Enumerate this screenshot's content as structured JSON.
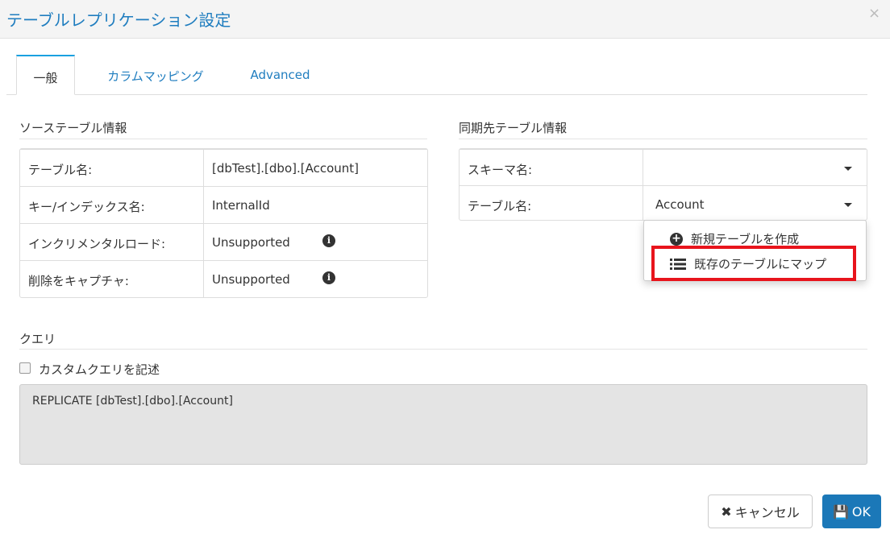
{
  "dialog": {
    "title": "テーブルレプリケーション設定",
    "close": "×"
  },
  "tabs": [
    {
      "label": "一般"
    },
    {
      "label": "カラムマッピング"
    },
    {
      "label": "Advanced"
    }
  ],
  "source": {
    "heading": "ソーステーブル情報",
    "rows": [
      {
        "label": "テーブル名:",
        "value": "[dbTest].[dbo].[Account]"
      },
      {
        "label": "キー/インデックス名:",
        "value": "InternalId"
      },
      {
        "label": "インクリメンタルロード:",
        "value": "Unsupported"
      },
      {
        "label": "削除をキャプチャ:",
        "value": "Unsupported"
      }
    ]
  },
  "target": {
    "heading": "同期先テーブル情報",
    "rows": [
      {
        "label": "スキーマ名:",
        "value": ""
      },
      {
        "label": "テーブル名:",
        "value": "Account"
      }
    ]
  },
  "menu": {
    "items": [
      {
        "label": "新規テーブルを作成",
        "icon": "plus-circle-icon"
      },
      {
        "label": "既存のテーブルにマップ",
        "icon": "list-icon"
      }
    ],
    "highlight_color": "#e8141c"
  },
  "query": {
    "heading": "クエリ",
    "checkbox_label": "カスタムクエリを記述",
    "checked": false,
    "text": "REPLICATE [dbTest].[dbo].[Account]"
  },
  "buttons": {
    "cancel": "キャンセル",
    "ok": "OK"
  }
}
